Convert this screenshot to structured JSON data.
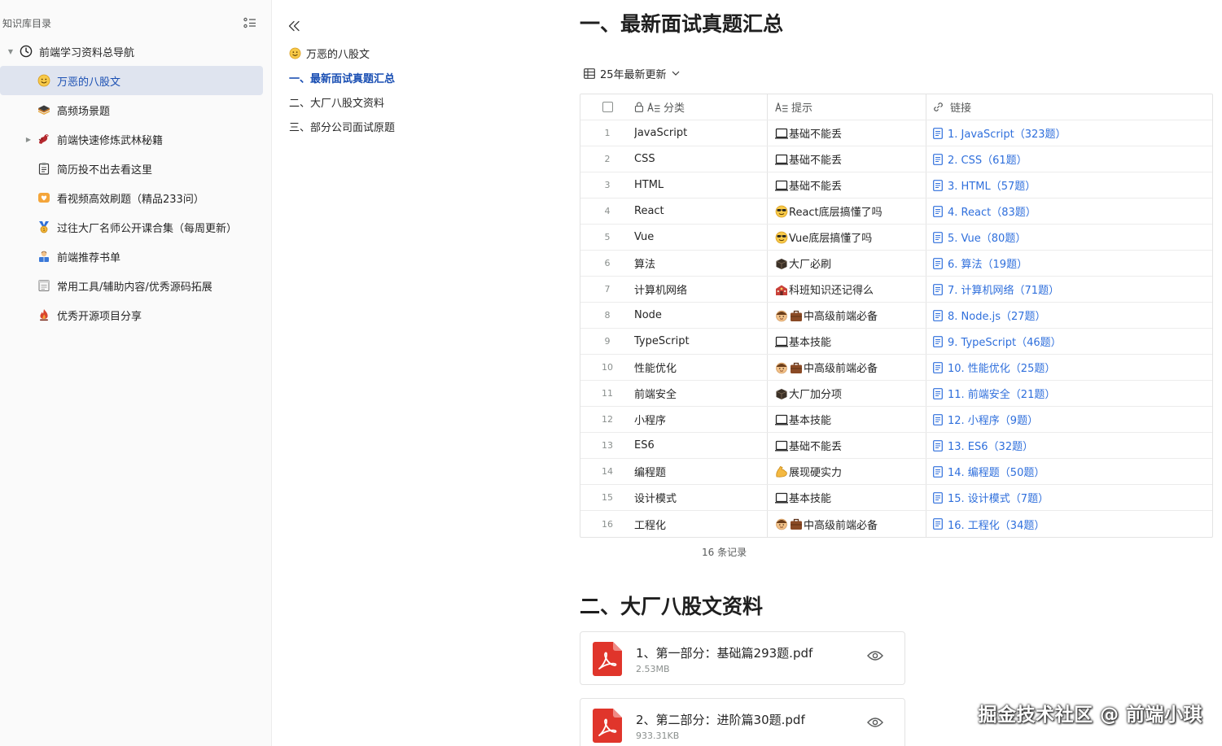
{
  "sidebar": {
    "title": "知识库目录",
    "items": [
      {
        "label": "前端学习资料总导航",
        "icon": "clock-icon",
        "level": 0,
        "expanded": true
      },
      {
        "label": "万恶的八股文",
        "icon": "smile-emoji-icon",
        "level": 1,
        "active": true
      },
      {
        "label": "高频场景题",
        "icon": "stack-icon",
        "level": 1
      },
      {
        "label": "前端快速修炼武林秘籍",
        "icon": "dragon-icon",
        "level": 1,
        "collapsed": true
      },
      {
        "label": "简历投不出去看这里",
        "icon": "clipboard-icon",
        "level": 1
      },
      {
        "label": "看视频高效刷题（精品233问）",
        "icon": "video-icon",
        "level": 1
      },
      {
        "label": "过往大厂名师公开课合集（每周更新）",
        "icon": "trophy-icon",
        "level": 1
      },
      {
        "label": "前端推荐书单",
        "icon": "reader-icon",
        "level": 1
      },
      {
        "label": "常用工具/辅助内容/优秀源码拓展",
        "icon": "notebook-icon",
        "level": 1
      },
      {
        "label": "优秀开源项目分享",
        "icon": "fire-icon",
        "level": 1
      }
    ]
  },
  "toc": {
    "items": [
      {
        "label": "万恶的八股文",
        "current": false
      },
      {
        "label": "一、最新面试真题汇总",
        "current": true
      },
      {
        "label": "二、大厂八股文资料",
        "current": false
      },
      {
        "label": "三、部分公司面试原题",
        "current": false
      }
    ]
  },
  "main": {
    "heading1": "一、最新面试真题汇总",
    "view_name": "25年最新更新",
    "table": {
      "headers": {
        "category": "分类",
        "tip": "提示",
        "link": "链接"
      },
      "rows": [
        {
          "idx": "1",
          "category": "JavaScript",
          "tip": "基础不能丢",
          "tip_icon": "laptop",
          "link": "1. JavaScript（323题）"
        },
        {
          "idx": "2",
          "category": "CSS",
          "tip": "基础不能丢",
          "tip_icon": "laptop",
          "link": "2. CSS（61题）"
        },
        {
          "idx": "3",
          "category": "HTML",
          "tip": "基础不能丢",
          "tip_icon": "laptop",
          "link": "3. HTML（57题）"
        },
        {
          "idx": "4",
          "category": "React",
          "tip": "React底层搞懂了吗",
          "tip_icon": "cool",
          "link": "4. React（83题）"
        },
        {
          "idx": "5",
          "category": "Vue",
          "tip": "Vue底层搞懂了吗",
          "tip_icon": "cool",
          "link": "5. Vue（80题）"
        },
        {
          "idx": "6",
          "category": "算法",
          "tip": "大厂必刷",
          "tip_icon": "box",
          "link": "6. 算法（19题）"
        },
        {
          "idx": "7",
          "category": "计算机网络",
          "tip": "科班知识还记得么",
          "tip_icon": "school",
          "link": "7. 计算机网络（71题）"
        },
        {
          "idx": "8",
          "category": "Node",
          "tip": "中高级前端必备",
          "tip_icon": "worker",
          "link": "8. Node.js（27题）"
        },
        {
          "idx": "9",
          "category": "TypeScript",
          "tip": "基本技能",
          "tip_icon": "laptop",
          "link": "9. TypeScript（46题）"
        },
        {
          "idx": "10",
          "category": "性能优化",
          "tip": "中高级前端必备",
          "tip_icon": "worker",
          "link": "10. 性能优化（25题）"
        },
        {
          "idx": "11",
          "category": "前端安全",
          "tip": "大厂加分项",
          "tip_icon": "box",
          "link": "11. 前端安全（21题）"
        },
        {
          "idx": "12",
          "category": "小程序",
          "tip": "基本技能",
          "tip_icon": "laptop",
          "link": "12. 小程序（9题）"
        },
        {
          "idx": "13",
          "category": "ES6",
          "tip": "基础不能丢",
          "tip_icon": "laptop",
          "link": "13. ES6（32题）"
        },
        {
          "idx": "14",
          "category": "编程题",
          "tip": "展现硬实力",
          "tip_icon": "muscle",
          "link": "14. 编程题（50题）"
        },
        {
          "idx": "15",
          "category": "设计模式",
          "tip": "基本技能",
          "tip_icon": "laptop",
          "link": "15. 设计模式（7题）"
        },
        {
          "idx": "16",
          "category": "工程化",
          "tip": "中高级前端必备",
          "tip_icon": "worker",
          "link": "16. 工程化（34题）"
        }
      ],
      "record_count": "16 条记录"
    },
    "heading2": "二、大厂八股文资料",
    "files": [
      {
        "name": "1、第一部分：基础篇293题.pdf",
        "size": "2.53MB"
      },
      {
        "name": "2、第二部分：进阶篇30题.pdf",
        "size": "933.31KB"
      }
    ]
  },
  "watermark": "掘金技术社区 @ 前端小琪",
  "colors": {
    "accent": "#1a4fb3",
    "link": "#2f6fdc",
    "active_bg": "#dfe4ef",
    "pdf_red": "#e0352b"
  }
}
